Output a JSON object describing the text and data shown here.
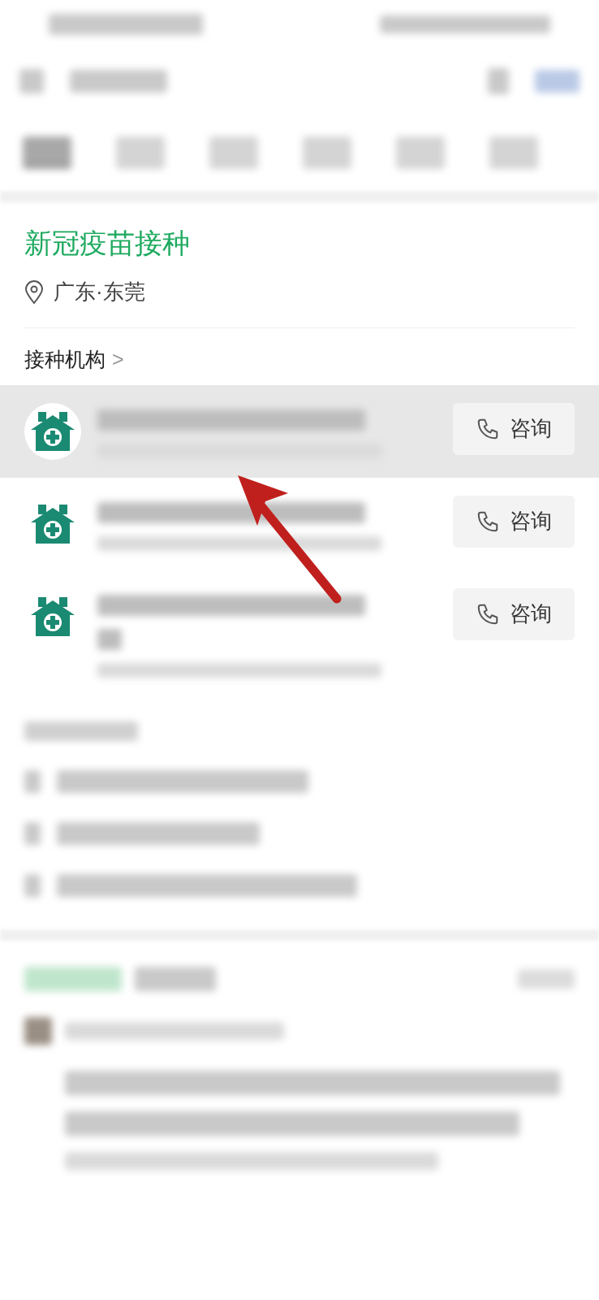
{
  "tabs": [
    {
      "selected": true
    },
    {
      "selected": false
    },
    {
      "selected": false
    },
    {
      "selected": false
    },
    {
      "selected": false
    },
    {
      "selected": false
    }
  ],
  "title": "新冠疫苗接种",
  "location": "广东·东莞",
  "section": {
    "label": "接种机构",
    "chevron": ">"
  },
  "institutions": [
    {
      "selected": true,
      "button": "咨询",
      "wrapped": false
    },
    {
      "selected": false,
      "button": "咨询",
      "wrapped": false
    },
    {
      "selected": false,
      "button": "咨询",
      "wrapped": true
    }
  ],
  "annotation": {
    "kind": "arrow"
  }
}
